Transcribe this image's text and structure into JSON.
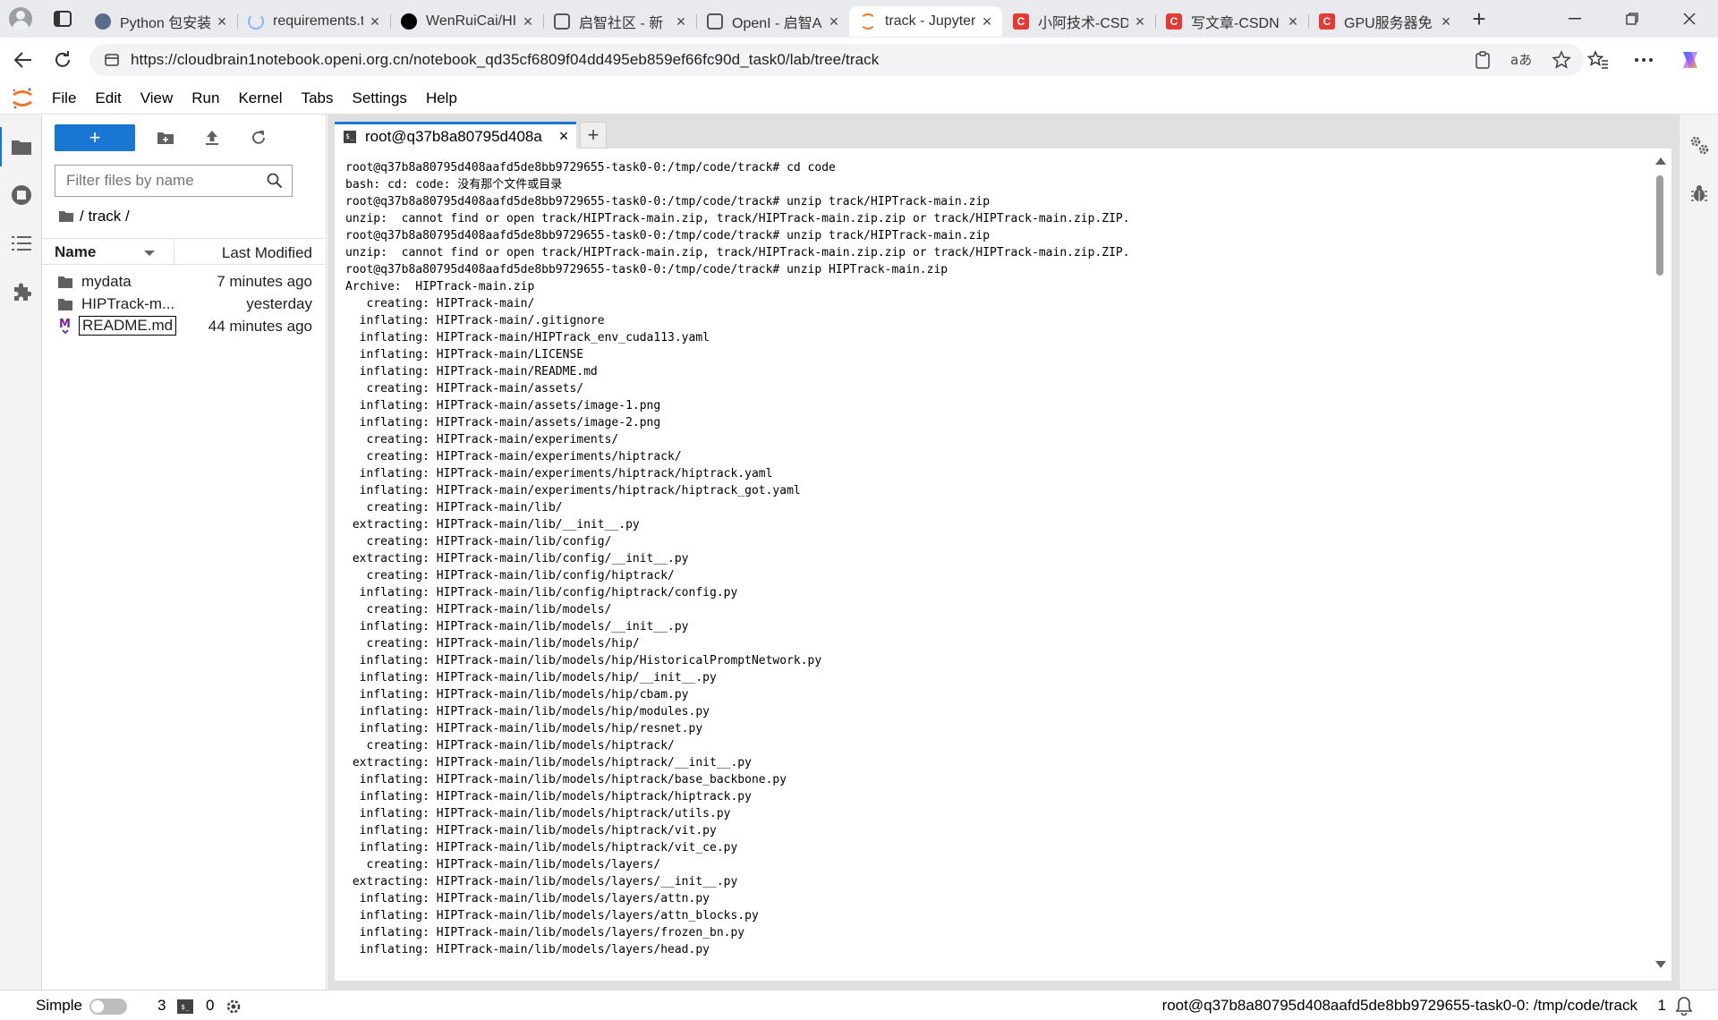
{
  "browser": {
    "tabs": [
      {
        "title": "Python 包安装",
        "favicon": "avatar-icon",
        "color": "#5b6b8c"
      },
      {
        "title": "requirements.t",
        "favicon": "loading-icon",
        "color": "#8ab4f8"
      },
      {
        "title": "WenRuiCai/HI",
        "favicon": "github-icon",
        "color": "#000000"
      },
      {
        "title": "启智社区 - 新",
        "favicon": "openi-icon",
        "color": "#555555"
      },
      {
        "title": "OpenI - 启智A",
        "favicon": "openi-icon",
        "color": "#555555"
      },
      {
        "title": "track - Jupyter",
        "favicon": "jupyter-icon",
        "color": "#f37726",
        "active": true
      },
      {
        "title": "小阿技术-CSD",
        "favicon": "csdn-icon",
        "color": "#e53935"
      },
      {
        "title": "写文章-CSDN",
        "favicon": "csdn-icon",
        "color": "#e53935"
      },
      {
        "title": "GPU服务器免",
        "favicon": "csdn-icon",
        "color": "#e53935"
      }
    ],
    "url": "https://cloudbrain1notebook.openi.org.cn/notebook_qd35cf6809f04dd495eb859ef66fc90d_task0/lab/tree/track"
  },
  "menu": {
    "items": [
      "File",
      "Edit",
      "View",
      "Run",
      "Kernel",
      "Tabs",
      "Settings",
      "Help"
    ]
  },
  "filebrowser": {
    "new_label": "+",
    "filter_placeholder": "Filter files by name",
    "breadcrumb": "/ track /",
    "column_name": "Name",
    "column_modified": "Last Modified",
    "files": [
      {
        "name": "mydata",
        "modified": "7 minutes ago",
        "type": "folder"
      },
      {
        "name": "HIPTrack-m...",
        "modified": "yesterday",
        "type": "folder"
      },
      {
        "name": "README.md",
        "modified": "44 minutes ago",
        "type": "markdown"
      }
    ]
  },
  "terminal": {
    "tab_title": "root@q37b8a80795d408a",
    "tab_icon_text": "$_",
    "lines": [
      "root@q37b8a80795d408aafd5de8bb9729655-task0-0:/tmp/code/track# cd code",
      "bash: cd: code: 没有那个文件或目录",
      "root@q37b8a80795d408aafd5de8bb9729655-task0-0:/tmp/code/track# unzip track/HIPTrack-main.zip",
      "unzip:  cannot find or open track/HIPTrack-main.zip, track/HIPTrack-main.zip.zip or track/HIPTrack-main.zip.ZIP.",
      "root@q37b8a80795d408aafd5de8bb9729655-task0-0:/tmp/code/track# unzip track/HIPTrack-main.zip",
      "unzip:  cannot find or open track/HIPTrack-main.zip, track/HIPTrack-main.zip.zip or track/HIPTrack-main.zip.ZIP.",
      "root@q37b8a80795d408aafd5de8bb9729655-task0-0:/tmp/code/track# unzip HIPTrack-main.zip",
      "Archive:  HIPTrack-main.zip",
      "   creating: HIPTrack-main/",
      "  inflating: HIPTrack-main/.gitignore",
      "  inflating: HIPTrack-main/HIPTrack_env_cuda113.yaml",
      "  inflating: HIPTrack-main/LICENSE",
      "  inflating: HIPTrack-main/README.md",
      "   creating: HIPTrack-main/assets/",
      "  inflating: HIPTrack-main/assets/image-1.png",
      "  inflating: HIPTrack-main/assets/image-2.png",
      "   creating: HIPTrack-main/experiments/",
      "   creating: HIPTrack-main/experiments/hiptrack/",
      "  inflating: HIPTrack-main/experiments/hiptrack/hiptrack.yaml",
      "  inflating: HIPTrack-main/experiments/hiptrack/hiptrack_got.yaml",
      "   creating: HIPTrack-main/lib/",
      " extracting: HIPTrack-main/lib/__init__.py",
      "   creating: HIPTrack-main/lib/config/",
      " extracting: HIPTrack-main/lib/config/__init__.py",
      "   creating: HIPTrack-main/lib/config/hiptrack/",
      "  inflating: HIPTrack-main/lib/config/hiptrack/config.py",
      "   creating: HIPTrack-main/lib/models/",
      "  inflating: HIPTrack-main/lib/models/__init__.py",
      "   creating: HIPTrack-main/lib/models/hip/",
      "  inflating: HIPTrack-main/lib/models/hip/HistoricalPromptNetwork.py",
      "  inflating: HIPTrack-main/lib/models/hip/__init__.py",
      "  inflating: HIPTrack-main/lib/models/hip/cbam.py",
      "  inflating: HIPTrack-main/lib/models/hip/modules.py",
      "  inflating: HIPTrack-main/lib/models/hip/resnet.py",
      "   creating: HIPTrack-main/lib/models/hiptrack/",
      " extracting: HIPTrack-main/lib/models/hiptrack/__init__.py",
      "  inflating: HIPTrack-main/lib/models/hiptrack/base_backbone.py",
      "  inflating: HIPTrack-main/lib/models/hiptrack/hiptrack.py",
      "  inflating: HIPTrack-main/lib/models/hiptrack/utils.py",
      "  inflating: HIPTrack-main/lib/models/hiptrack/vit.py",
      "  inflating: HIPTrack-main/lib/models/hiptrack/vit_ce.py",
      "   creating: HIPTrack-main/lib/models/layers/",
      " extracting: HIPTrack-main/lib/models/layers/__init__.py",
      "  inflating: HIPTrack-main/lib/models/layers/attn.py",
      "  inflating: HIPTrack-main/lib/models/layers/attn_blocks.py",
      "  inflating: HIPTrack-main/lib/models/layers/frozen_bn.py",
      "  inflating: HIPTrack-main/lib/models/layers/head.py"
    ]
  },
  "statusbar": {
    "mode_label": "Simple",
    "terminals_count": "3",
    "kernels_count": "0",
    "path": "root@q37b8a80795d408aafd5de8bb9729655-task0-0: /tmp/code/track",
    "notifications_count": "1"
  },
  "colors": {
    "accent": "#1976d2",
    "jupyter_orange": "#f37726"
  }
}
